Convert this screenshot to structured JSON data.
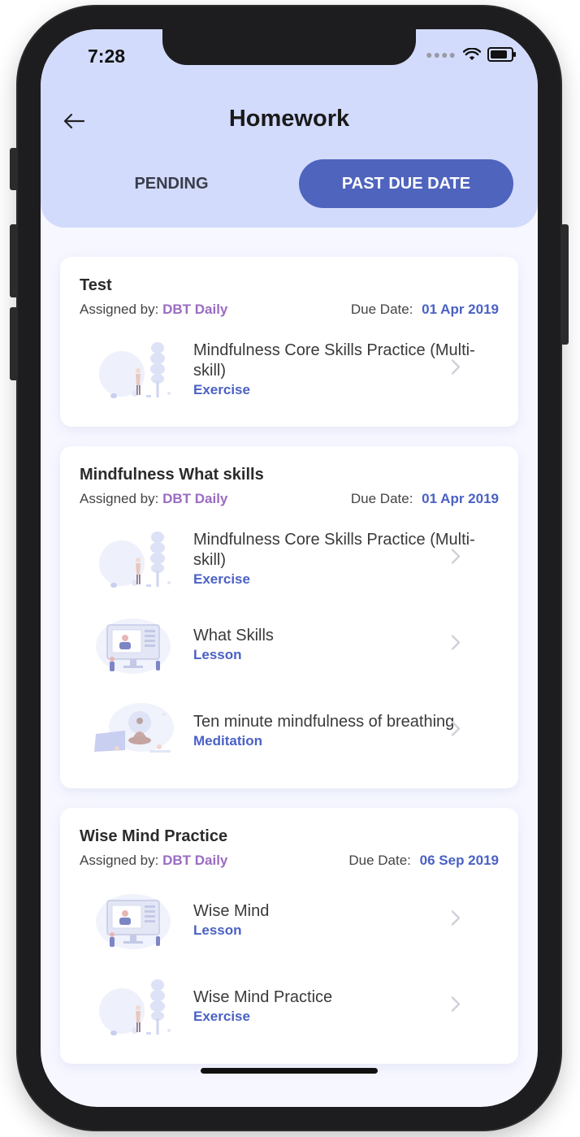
{
  "status": {
    "time": "7:28"
  },
  "header": {
    "title": "Homework"
  },
  "tabs": [
    {
      "label": "PENDING",
      "active": false
    },
    {
      "label": "PAST DUE DATE",
      "active": true
    }
  ],
  "labels": {
    "assigned_by": "Assigned by:",
    "due_date": "Due Date:"
  },
  "cards": [
    {
      "title": "Test",
      "assigned_by": "DBT Daily",
      "due_date": "01 Apr 2019",
      "items": [
        {
          "name": "Mindfulness Core Skills Practice (Multi-skill)",
          "type": "Exercise",
          "thumb": "exercise-illustration"
        }
      ]
    },
    {
      "title": "Mindfulness What skills",
      "assigned_by": "DBT Daily",
      "due_date": "01 Apr 2019",
      "items": [
        {
          "name": "Mindfulness Core Skills Practice (Multi-skill)",
          "type": "Exercise",
          "thumb": "exercise-illustration"
        },
        {
          "name": "What Skills",
          "type": "Lesson",
          "thumb": "lesson-illustration"
        },
        {
          "name": "Ten minute mindfulness of breathing",
          "type": "Meditation",
          "thumb": "meditation-illustration"
        }
      ]
    },
    {
      "title": "Wise Mind Practice",
      "assigned_by": "DBT Daily",
      "due_date": "06 Sep 2019",
      "items": [
        {
          "name": "Wise Mind",
          "type": "Lesson",
          "thumb": "lesson-illustration"
        },
        {
          "name": "Wise Mind Practice",
          "type": "Exercise",
          "thumb": "exercise-illustration"
        }
      ]
    }
  ],
  "colors": {
    "header_bg": "#d3dbfc",
    "accent": "#4f64bd",
    "assigned_by": "#9a6cc2",
    "due_date": "#4a61c4"
  }
}
